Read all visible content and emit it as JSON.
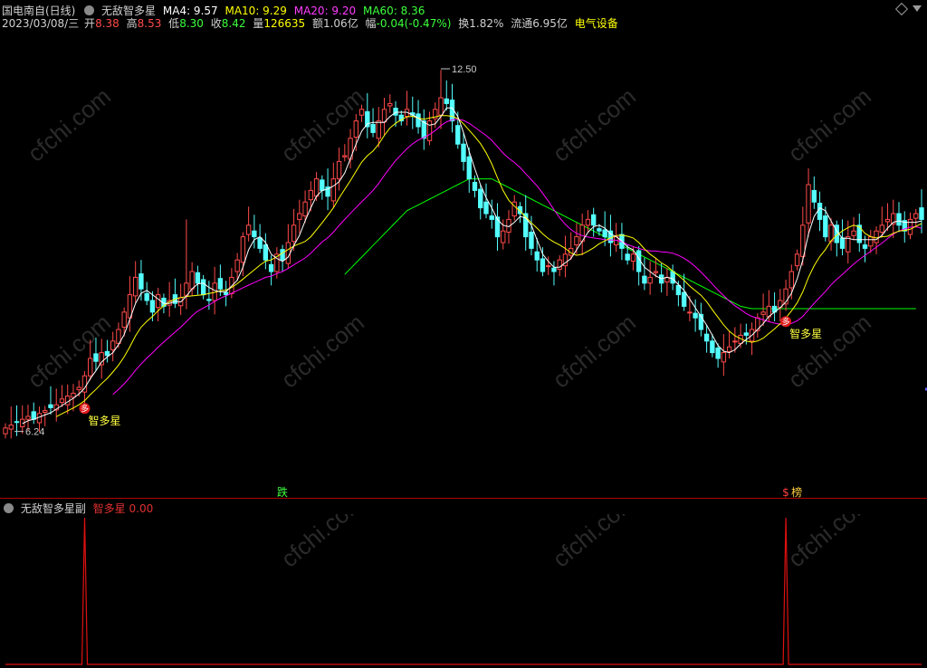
{
  "header": {
    "stock": "国电南自(日线)",
    "indicator": "无敌智多星",
    "ma4": "MA4: 9.57",
    "ma10": "MA10: 9.29",
    "ma20": "MA20: 9.20",
    "ma60": "MA60: 8.36"
  },
  "info": {
    "date": "2023/03/08/三",
    "open_label": "开",
    "open": "8.38",
    "high_label": "高",
    "high": "8.53",
    "low_label": "低",
    "low": "8.30",
    "close_label": "收",
    "close": "8.42",
    "vol_label": "量",
    "vol": "126635",
    "amt_label": "额",
    "amt": "1.06亿",
    "chg_label": "幅",
    "chg": "-0.04(-0.47%)",
    "turnover": "换1.82%",
    "float": "流通6.95亿",
    "sector": "电气设备"
  },
  "annotations": {
    "high_price": "12.50",
    "low_price": "6.24",
    "signal_icon": "多",
    "signal_label": "智多星",
    "marker_left": "跌",
    "marker_right_icon": "$",
    "marker_right": "榜"
  },
  "sub": {
    "title": "无敌智多星副",
    "series_label": "智多星",
    "value": "0.00"
  },
  "colors": {
    "up": "#ff4a4a",
    "down": "#54ffff",
    "ma4": "#ffffff",
    "ma10": "#ffff00",
    "ma20": "#ff00ff",
    "ma60": "#00ff00",
    "sub_line": "#e01010",
    "divider": "#b00000"
  },
  "chart_data": [
    {
      "type": "candlestick",
      "ylim": [
        6.0,
        13.0
      ],
      "high_label_value": 12.5,
      "low_label_value": 6.24,
      "closes": [
        6.3,
        6.35,
        6.4,
        6.45,
        6.5,
        6.45,
        6.55,
        6.6,
        6.65,
        6.7,
        6.8,
        6.85,
        6.9,
        7.0,
        7.2,
        7.5,
        7.45,
        7.6,
        7.55,
        7.8,
        8.0,
        8.3,
        8.6,
        8.9,
        8.7,
        8.5,
        8.3,
        8.6,
        8.4,
        8.5,
        8.45,
        8.55,
        8.8,
        9.0,
        8.8,
        8.6,
        8.5,
        8.8,
        8.7,
        8.6,
        8.9,
        9.2,
        9.6,
        9.8,
        9.6,
        9.4,
        9.2,
        9.0,
        9.3,
        9.2,
        9.5,
        9.8,
        10.0,
        10.2,
        10.4,
        10.6,
        10.4,
        10.3,
        10.6,
        10.9,
        11.0,
        11.3,
        11.6,
        11.8,
        11.5,
        11.4,
        11.6,
        11.8,
        11.9,
        11.7,
        11.6,
        11.8,
        11.7,
        11.5,
        11.3,
        11.6,
        11.8,
        12.0,
        11.9,
        11.6,
        11.2,
        10.9,
        10.6,
        10.4,
        10.1,
        10.0,
        9.9,
        9.6,
        9.7,
        9.9,
        10.2,
        10.0,
        9.6,
        9.4,
        9.2,
        9.0,
        9.1,
        9.0,
        9.2,
        9.3,
        9.4,
        9.6,
        9.8,
        9.9,
        9.8,
        9.7,
        9.6,
        9.5,
        9.6,
        9.4,
        9.2,
        9.3,
        9.0,
        8.8,
        8.9,
        9.0,
        8.8,
        8.9,
        8.8,
        8.6,
        8.4,
        8.3,
        8.2,
        8.0,
        7.8,
        7.6,
        7.5,
        7.6,
        7.7,
        7.8,
        7.9,
        7.9,
        8.0,
        8.2,
        8.3,
        8.4,
        8.3,
        8.5,
        8.7,
        9.0,
        9.3,
        9.8,
        10.5,
        10.2,
        9.9,
        9.6,
        9.8,
        9.5,
        9.4,
        9.6,
        9.7,
        9.5,
        9.4,
        9.6,
        9.7,
        9.8,
        9.9,
        10.0,
        9.8,
        9.7,
        9.9,
        10.0,
        9.9
      ],
      "ma60": [
        null,
        null,
        null,
        null,
        null,
        null,
        null,
        null,
        null,
        null,
        null,
        null,
        null,
        null,
        null,
        null,
        null,
        null,
        null,
        null,
        null,
        null,
        null,
        null,
        null,
        null,
        null,
        null,
        null,
        null,
        null,
        null,
        null,
        null,
        null,
        null,
        null,
        null,
        null,
        null,
        null,
        null,
        null,
        null,
        null,
        null,
        null,
        null,
        null,
        null,
        null,
        null,
        null,
        null,
        null,
        null,
        null,
        null,
        null,
        null,
        8.95,
        9.05,
        9.15,
        9.25,
        9.35,
        9.45,
        9.55,
        9.65,
        9.75,
        9.85,
        9.95,
        10.05,
        10.1,
        10.15,
        10.2,
        10.25,
        10.3,
        10.35,
        10.4,
        10.45,
        10.5,
        10.55,
        10.6,
        10.6,
        10.6,
        10.6,
        10.6,
        10.55,
        10.5,
        10.45,
        10.4,
        10.35,
        10.3,
        10.25,
        10.2,
        10.15,
        10.1,
        10.05,
        10.0,
        9.95,
        9.9,
        9.85,
        9.8,
        9.75,
        9.7,
        9.65,
        9.6,
        9.55,
        9.5,
        9.45,
        9.4,
        9.35,
        9.3,
        9.25,
        9.2,
        9.15,
        9.1,
        9.05,
        9.0,
        8.95,
        8.9,
        8.85,
        8.8,
        8.75,
        8.7,
        8.65,
        8.6,
        8.55,
        8.5,
        8.45,
        8.4,
        8.38,
        8.36,
        8.36,
        8.36,
        8.36,
        8.36,
        8.36,
        8.36,
        8.36,
        8.36,
        8.36,
        8.36,
        8.36,
        8.36,
        8.36,
        8.36,
        8.36,
        8.36,
        8.36,
        8.36,
        8.36,
        8.36,
        8.36,
        8.36,
        8.36,
        8.36,
        8.36,
        8.36,
        8.36,
        8.36,
        8.36
      ],
      "signal_indices": [
        14,
        138
      ]
    },
    {
      "type": "line",
      "name": "智多星",
      "ylim": [
        0,
        1
      ],
      "signal_indices": [
        14,
        138
      ],
      "signal_value": 1
    }
  ]
}
